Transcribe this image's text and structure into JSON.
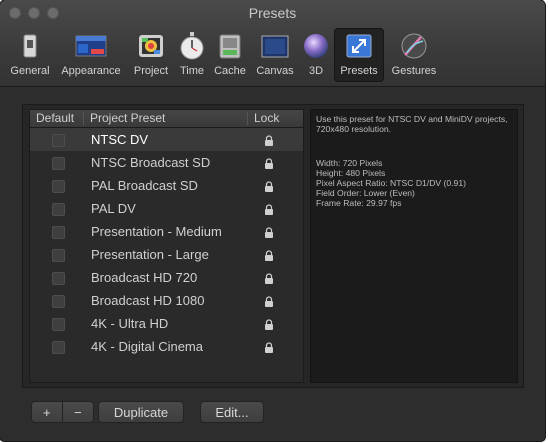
{
  "window": {
    "title": "Presets"
  },
  "toolbar": {
    "items": [
      {
        "label": "General",
        "icon": "switch-icon"
      },
      {
        "label": "Appearance",
        "icon": "appearance-icon"
      },
      {
        "label": "Project",
        "icon": "project-icon"
      },
      {
        "label": "Time",
        "icon": "stopwatch-icon"
      },
      {
        "label": "Cache",
        "icon": "cache-icon"
      },
      {
        "label": "Canvas",
        "icon": "canvas-icon"
      },
      {
        "label": "3D",
        "icon": "3d-sphere-icon"
      },
      {
        "label": "Presets",
        "icon": "presets-icon",
        "selected": true
      },
      {
        "label": "Gestures",
        "icon": "gestures-icon"
      }
    ]
  },
  "table": {
    "columns": {
      "default": "Default",
      "preset": "Project Preset",
      "lock": "Lock"
    },
    "rows": [
      {
        "name": "NTSC DV",
        "selected": true
      },
      {
        "name": "NTSC Broadcast SD"
      },
      {
        "name": "PAL Broadcast SD"
      },
      {
        "name": "PAL DV"
      },
      {
        "name": "Presentation - Medium"
      },
      {
        "name": "Presentation - Large"
      },
      {
        "name": "Broadcast HD 720"
      },
      {
        "name": "Broadcast HD 1080"
      },
      {
        "name": "4K - Ultra HD"
      },
      {
        "name": "4K - Digital Cinema"
      }
    ]
  },
  "description": {
    "summary_line1": "Use this preset for NTSC DV and MiniDV projects,",
    "summary_line2": "720x480 resolution.",
    "width": "Width: 720 Pixels",
    "height": "Height: 480 Pixels",
    "pixel_aspect": "Pixel Aspect Ratio: NTSC D1/DV (0.91)",
    "field_order": "Field Order: Lower (Even)",
    "frame_rate": "Frame Rate: 29.97 fps"
  },
  "buttons": {
    "add": "+",
    "remove": "−",
    "duplicate": "Duplicate",
    "edit": "Edit..."
  }
}
